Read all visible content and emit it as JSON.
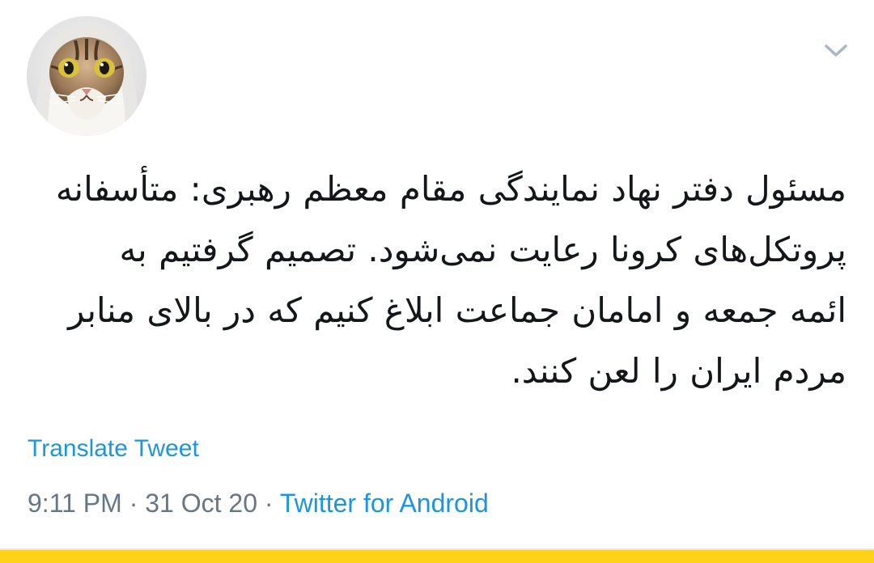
{
  "tweet": {
    "avatar_icon": "cat-avatar",
    "menu_icon": "chevron-down-icon",
    "lines": [
      "مسئول دفتر نهاد نمایندگی مقام معظم رهبری: متأسفانه",
      "پروتکل‌های کرونا رعایت نمی‌شود. تصمیم گرفتیم به",
      "ائمه جمعه و امامان جماعت ابلاغ کنیم که در بالای منابر",
      "مردم ایران را لعن کنند."
    ],
    "translate_label": "Translate Tweet",
    "time": "9:11 PM",
    "separator": "·",
    "date": "31 Oct 20",
    "source": "Twitter for Android"
  },
  "colors": {
    "link": "#1b95e0",
    "text": "#14171a",
    "meta": "#657786",
    "bottom_band": "#ffd21a"
  }
}
